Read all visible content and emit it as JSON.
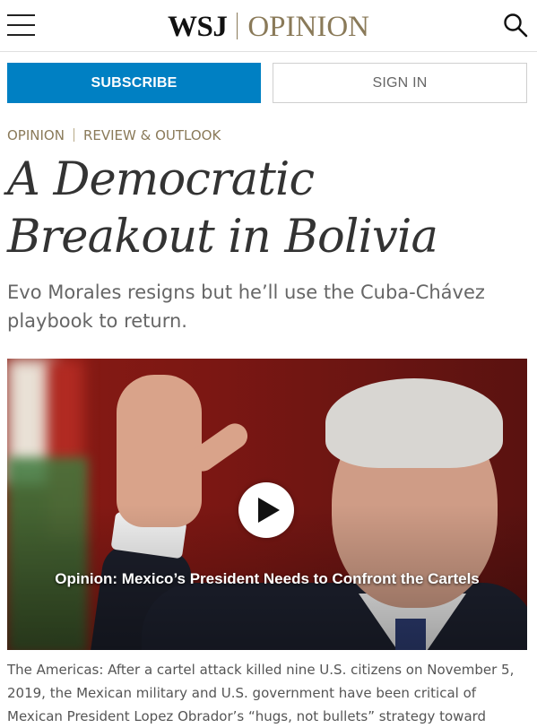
{
  "header": {
    "logo_wsj": "WSJ",
    "logo_section": "OPINION",
    "menu_icon": "hamburger-menu-icon",
    "search_icon": "search-icon"
  },
  "actions": {
    "subscribe_label": "SUBSCRIBE",
    "signin_label": "SIGN IN",
    "subscribe_color": "#0080c3"
  },
  "breadcrumb": {
    "section": "OPINION",
    "subsection": "REVIEW & OUTLOOK"
  },
  "article": {
    "headline": "A Democratic Breakout in Bolivia",
    "dek": "Evo Morales resigns but he’ll use the Cuba-Chávez playbook to return."
  },
  "video": {
    "play_icon": "play-icon",
    "caption": "Opinion: Mexico’s President Needs to Confront the Cartels",
    "description": "The Americas: After a cartel attack killed nine U.S. citizens on November 5, 2019, the Mexican military and U.S. government have been critical of Mexican President Lopez Obrador’s “hugs, not bullets” strategy toward"
  },
  "colors": {
    "accent_gold": "#8a7a59",
    "headline": "#333333"
  }
}
